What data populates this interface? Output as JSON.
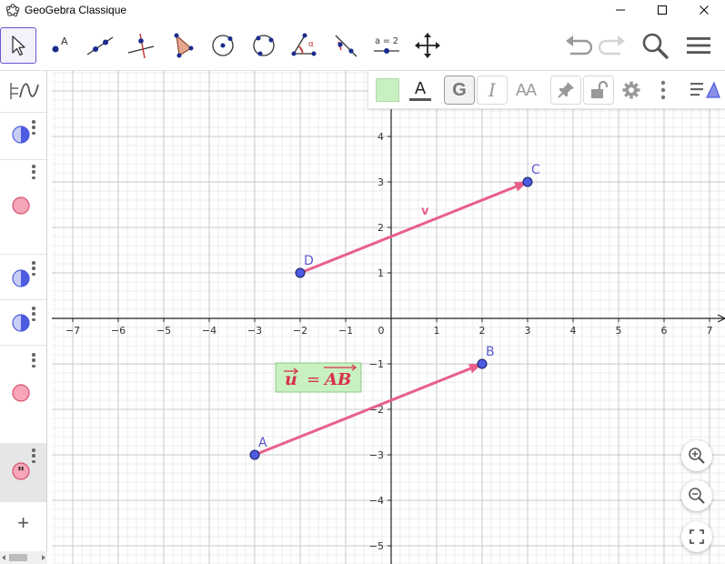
{
  "window": {
    "title": "GeoGebra Classique",
    "icon": "geogebra-icon"
  },
  "colors": {
    "accent": "#6557d2",
    "point_fill": "#4c5be0",
    "point_label": "#5a5acd",
    "vector": "#e8608a",
    "text_box_bg": "#c8f0c0",
    "text_box_text": "#d8304c",
    "grid_major": "#c8c8c8",
    "grid_minor": "#ececec"
  },
  "toolbar": {
    "tools": [
      {
        "icon": "move-arrow-icon"
      },
      {
        "icon": "point-icon",
        "label": "A"
      },
      {
        "icon": "line-icon"
      },
      {
        "icon": "perpendicular-line-icon"
      },
      {
        "icon": "polygon-icon"
      },
      {
        "icon": "circle-center-point-icon"
      },
      {
        "icon": "circle-three-points-icon"
      },
      {
        "icon": "angle-icon",
        "label": "α"
      },
      {
        "icon": "reflect-icon"
      },
      {
        "icon": "slider-icon",
        "label": "a = 2"
      },
      {
        "icon": "move-graphics-icon"
      }
    ],
    "right": [
      {
        "icon": "undo-icon"
      },
      {
        "icon": "redo-icon"
      },
      {
        "icon": "search-icon"
      },
      {
        "icon": "menu-icon"
      }
    ]
  },
  "stylebar": {
    "items": [
      {
        "icon": "color-swatch-icon"
      },
      {
        "icon": "text-color-icon",
        "label": "A"
      },
      {
        "icon": "bold-icon",
        "label": "G"
      },
      {
        "icon": "italic-icon",
        "label": "I"
      },
      {
        "icon": "font-size-icon",
        "label": "AA"
      },
      {
        "icon": "pin-icon"
      },
      {
        "icon": "lock-icon"
      },
      {
        "icon": "gear-icon"
      },
      {
        "icon": "more-vert-icon"
      },
      {
        "icon": "graphics-view-icon"
      }
    ]
  },
  "algebra": {
    "rows": [
      {
        "kind": "vector"
      },
      {
        "kind": "point"
      },
      {
        "kind": "vector"
      },
      {
        "kind": "vector"
      },
      {
        "kind": "point"
      },
      {
        "kind": "text",
        "selected": true
      }
    ],
    "add_label": "+"
  },
  "graph": {
    "x_range": [
      -7,
      7
    ],
    "y_range": [
      -5,
      4
    ],
    "x_ticks": [
      "−7",
      "−6",
      "−5",
      "−4",
      "−3",
      "−2",
      "−1",
      "0",
      "1",
      "2",
      "3",
      "4",
      "5",
      "6",
      "7"
    ],
    "y_ticks": [
      "4",
      "3",
      "2",
      "1",
      "−1",
      "−2",
      "−3",
      "−4",
      "−5"
    ],
    "origin_label": "0",
    "points": [
      {
        "name": "A",
        "x": -3,
        "y": -3
      },
      {
        "name": "B",
        "x": 2,
        "y": -1
      },
      {
        "name": "C",
        "x": 3,
        "y": 3
      },
      {
        "name": "D",
        "x": -2,
        "y": 1
      }
    ],
    "vectors": [
      {
        "from": "A",
        "to": "B",
        "label": ""
      },
      {
        "from": "D",
        "to": "C",
        "label": "v"
      }
    ],
    "text_box": {
      "expression": "u = AB",
      "lhs": "u",
      "rhs": "AB",
      "anchor_x": -2.3,
      "anchor_y": -1.4
    }
  },
  "zoom": [
    {
      "icon": "zoom-in-icon"
    },
    {
      "icon": "zoom-out-icon"
    },
    {
      "icon": "fullscreen-icon"
    }
  ]
}
